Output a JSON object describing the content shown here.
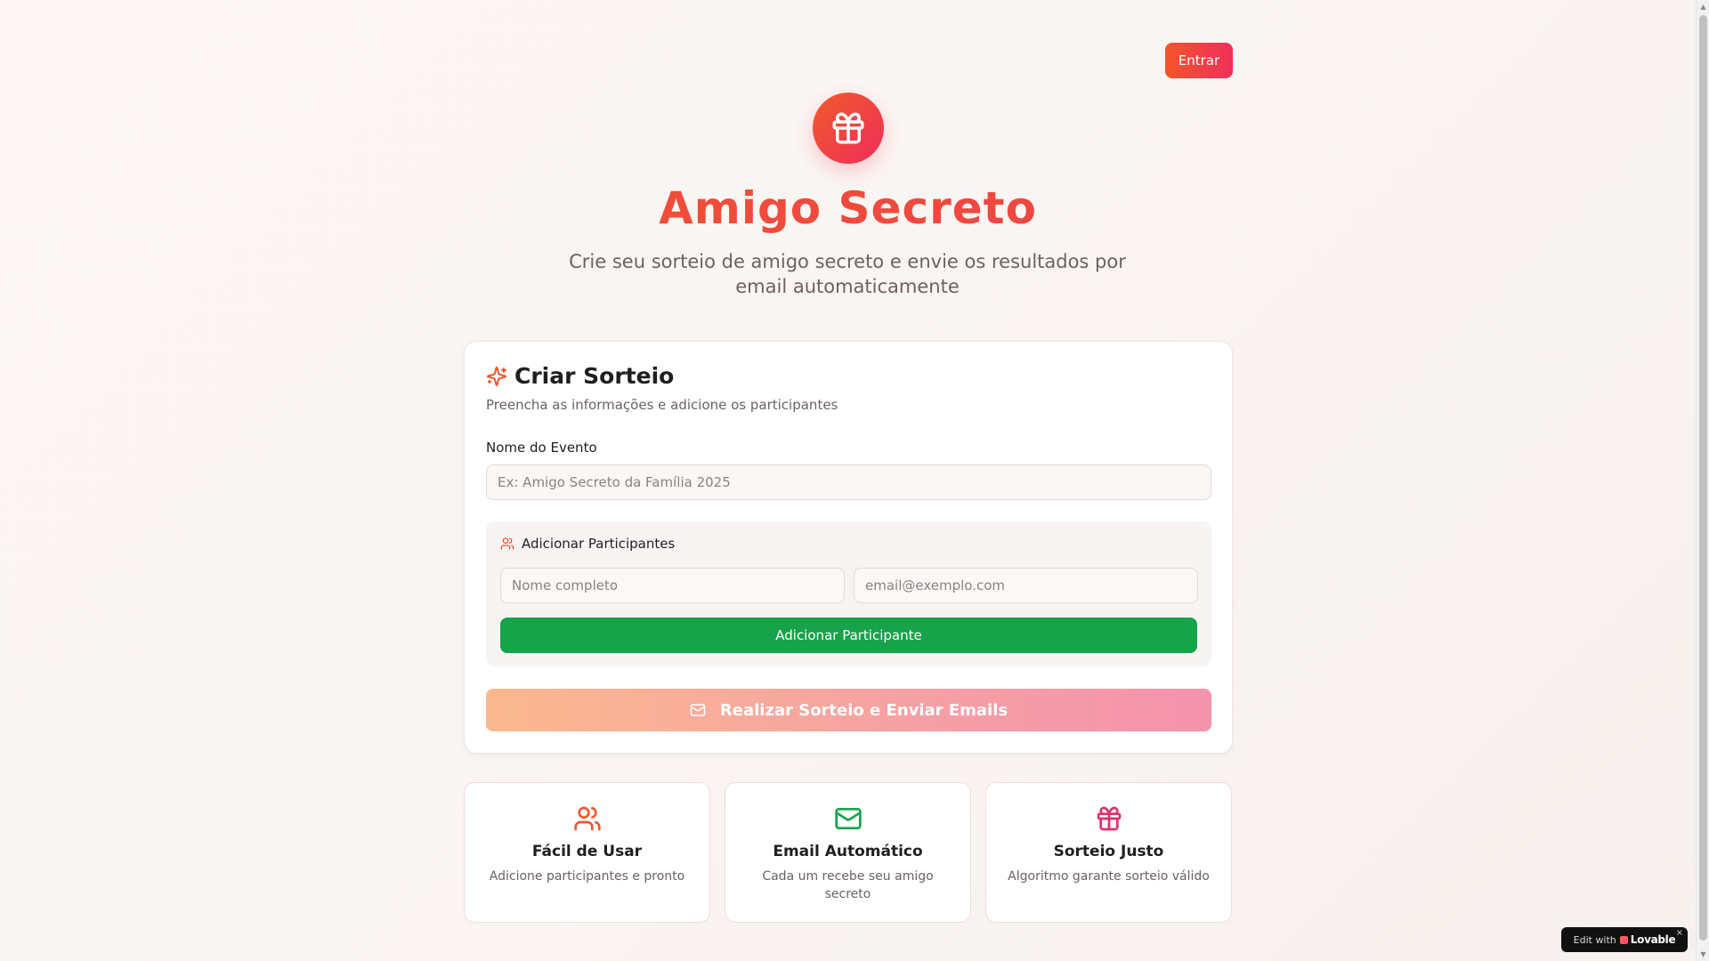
{
  "header": {
    "login_label": "Entrar"
  },
  "hero": {
    "title": "Amigo Secreto",
    "subtitle": "Crie seu sorteio de amigo secreto e envie os resultados por email automaticamente"
  },
  "form": {
    "title": "Criar Sorteio",
    "description": "Preencha as informações e adicione os participantes",
    "event_label": "Nome do Evento",
    "event_placeholder": "Ex: Amigo Secreto da Família 2025",
    "event_value": "",
    "participants": {
      "title": "Adicionar Participantes",
      "name_placeholder": "Nome completo",
      "email_placeholder": "email@exemplo.com",
      "add_label": "Adicionar Participante"
    },
    "submit_label": "Realizar Sorteio e Enviar Emails"
  },
  "features": [
    {
      "icon": "users-icon",
      "title": "Fácil de Usar",
      "description": "Adicione participantes e pronto"
    },
    {
      "icon": "mail-icon",
      "title": "Email Automático",
      "description": "Cada um recebe seu amigo secreto"
    },
    {
      "icon": "gift-icon",
      "title": "Sorteio Justo",
      "description": "Algoritmo garante sorteio válido"
    }
  ],
  "badge": {
    "edit_text": "Edit with",
    "brand": "Lovable",
    "close": "×"
  },
  "colors": {
    "primary_orange": "#f25a2a",
    "primary_pink": "#ee2e5b",
    "green": "#16a34a",
    "email_green": "#16a34a",
    "gift_pink": "#e0316e"
  }
}
